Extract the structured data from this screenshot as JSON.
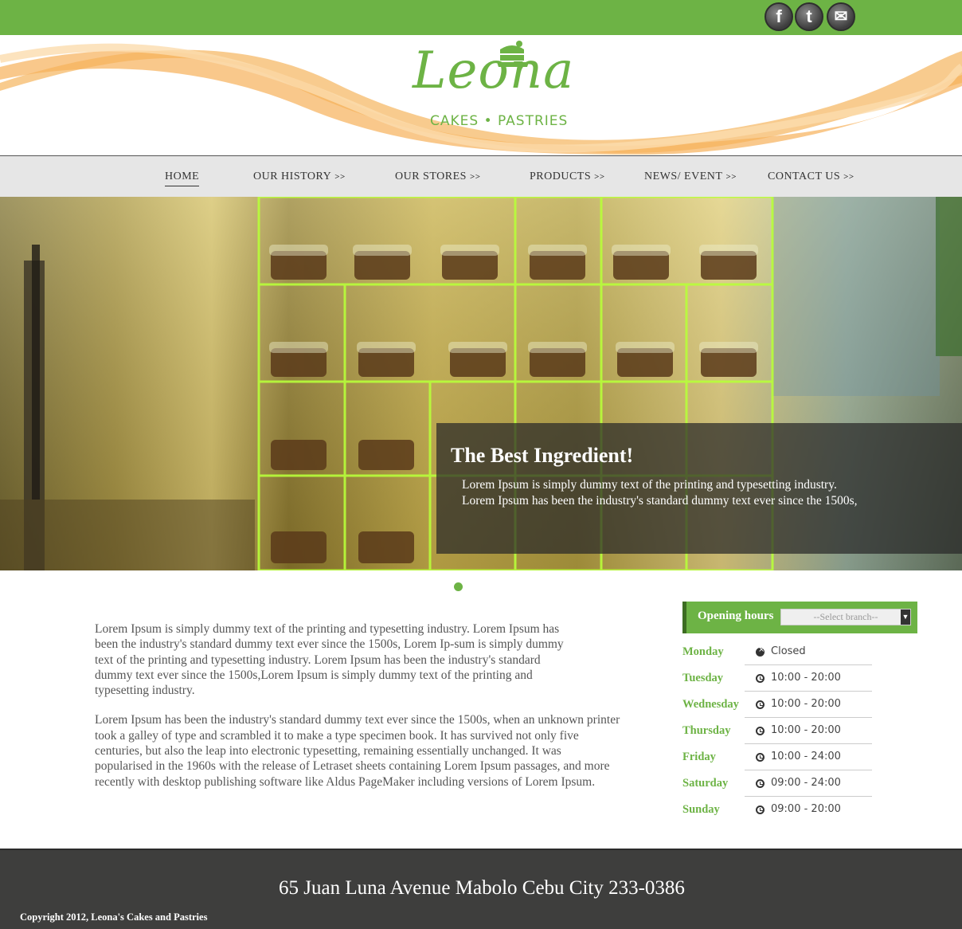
{
  "social": [
    {
      "name": "facebook",
      "glyph": "f"
    },
    {
      "name": "twitter",
      "glyph": "t"
    },
    {
      "name": "mail",
      "glyph": "✉"
    }
  ],
  "logo": {
    "word": "Leona",
    "tagline": "CAKES • PASTRIES"
  },
  "nav": {
    "items": [
      {
        "label": "HOME",
        "arrows": ""
      },
      {
        "label": "OUR HISTORY",
        "arrows": ">>"
      },
      {
        "label": "OUR STORES",
        "arrows": ">>"
      },
      {
        "label": "PRODUCTS",
        "arrows": ">>"
      },
      {
        "label": "NEWS/ EVENT",
        "arrows": ">>"
      },
      {
        "label": "CONTACT US",
        "arrows": ">>"
      }
    ]
  },
  "hero": {
    "title": "The Best Ingredient!",
    "line1": "Lorem Ipsum is simply dummy text of the printing and typesetting industry.",
    "line2": "Lorem Ipsum has been the industry's standard dummy text ever since the 1500s,"
  },
  "content": {
    "paragraph1": "Lorem Ipsum is simply dummy text of the printing and typesetting industry. Lorem Ipsum has been the industry's standard dummy text ever since the 1500s, Lorem Ip-sum is simply dummy text of the printing and typesetting industry. Lorem Ipsum has been the industry's standard dummy text ever since the 1500s,Lorem Ipsum is simply dummy text of the printing and typesetting industry.",
    "paragraph2": "Lorem Ipsum has been the industry's standard dummy text ever since the 1500s, when an unknown printer took a galley of type and scrambled it to make a type specimen book. It has survived not only five centuries, but also the leap into electronic typesetting, remaining essentially unchanged. It was popularised in the 1960s with the release of Letraset sheets containing Lorem Ipsum passages, and more recently with desktop publishing software like Aldus PageMaker including versions of Lorem Ipsum."
  },
  "hours": {
    "title": "Opening hours",
    "branch_select": "--Select branch--",
    "rows": [
      {
        "day": "Monday",
        "time": "Closed",
        "closed": true
      },
      {
        "day": "Tuesday",
        "time": "10:00 - 20:00",
        "closed": false
      },
      {
        "day": "Wednesday",
        "time": "10:00 - 20:00",
        "closed": false
      },
      {
        "day": "Thursday",
        "time": "10:00 - 20:00",
        "closed": false
      },
      {
        "day": "Friday",
        "time": "10:00 - 24:00",
        "closed": false
      },
      {
        "day": "Saturday",
        "time": "09:00 - 24:00",
        "closed": false
      },
      {
        "day": "Sunday",
        "time": "09:00 - 20:00",
        "closed": false
      }
    ]
  },
  "footer": {
    "address": "65 Juan Luna Avenue Mabolo Cebu City 233-0386",
    "copyright": "Copyright 2012, Leona's Cakes and Pastries"
  },
  "colors": {
    "brand_green": "#6db345",
    "footer_bg": "#3e3e3d",
    "swoosh_orange": "#f6b15a"
  }
}
